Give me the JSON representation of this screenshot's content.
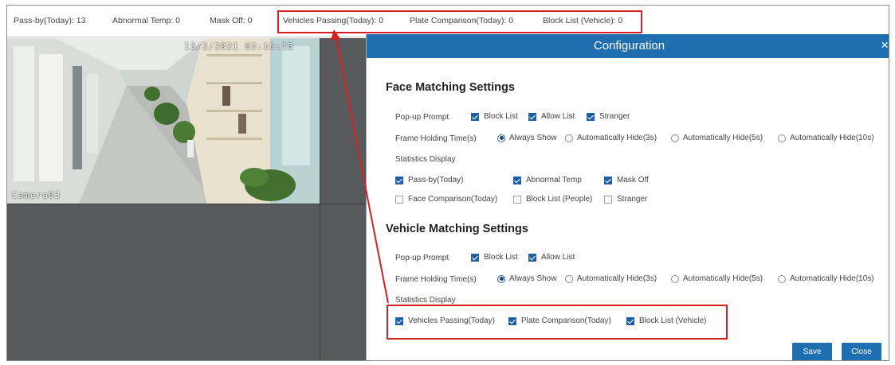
{
  "stats_bar": {
    "pass_by": "Pass-by(Today): 13",
    "abnormal_temp": "Abnormal Temp: 0",
    "mask_off": "Mask Off: 0",
    "vehicles_passing": "Vehicles Passing(Today): 0",
    "plate_comparison": "Plate Comparison(Today): 0",
    "block_list_vehicle": "Block List (Vehicle): 0"
  },
  "camera": {
    "timestamp": "13/2/2021 03:16:18",
    "name": "Camera03"
  },
  "dialog": {
    "title": "Configuration",
    "close_icon": "×",
    "face": {
      "title": "Face Matching Settings",
      "popup_label": "Pop-up Prompt",
      "popup_options": [
        {
          "label": "Block List",
          "checked": true
        },
        {
          "label": "Allow List",
          "checked": true
        },
        {
          "label": "Stranger",
          "checked": true
        }
      ],
      "frame_label": "Frame Holding Time(s)",
      "frame_options": [
        {
          "label": "Always Show",
          "selected": true
        },
        {
          "label": "Automatically Hide(3s)",
          "selected": false
        },
        {
          "label": "Automatically Hide(5s)",
          "selected": false
        },
        {
          "label": "Automatically Hide(10s)",
          "selected": false
        }
      ],
      "stats_label": "Statistics Display",
      "stats_options": [
        {
          "label": "Pass-by(Today)",
          "checked": true
        },
        {
          "label": "Abnormal Temp",
          "checked": true
        },
        {
          "label": "Mask Off",
          "checked": true
        },
        {
          "label": "Face Comparison(Today)",
          "checked": false
        },
        {
          "label": "Block List (People)",
          "checked": false
        },
        {
          "label": "Stranger",
          "checked": false
        }
      ]
    },
    "vehicle": {
      "title": "Vehicle Matching Settings",
      "popup_label": "Pop-up Prompt",
      "popup_options": [
        {
          "label": "Block List",
          "checked": true
        },
        {
          "label": "Allow List",
          "checked": true
        }
      ],
      "frame_label": "Frame Holding Time(s)",
      "frame_options": [
        {
          "label": "Always Show",
          "selected": true
        },
        {
          "label": "Automatically Hide(3s)",
          "selected": false
        },
        {
          "label": "Automatically Hide(5s)",
          "selected": false
        },
        {
          "label": "Automatically Hide(10s)",
          "selected": false
        }
      ],
      "stats_label": "Statistics Display",
      "stats_options": [
        {
          "label": "Vehicles Passing(Today)",
          "checked": true
        },
        {
          "label": "Plate Comparison(Today)",
          "checked": true
        },
        {
          "label": "Block List (Vehicle)",
          "checked": true
        }
      ]
    },
    "save_label": "Save",
    "close_label": "Close"
  },
  "colors": {
    "accent": "#1e6eb0",
    "highlight": "#d62020",
    "grid_bg": "#58595b"
  }
}
